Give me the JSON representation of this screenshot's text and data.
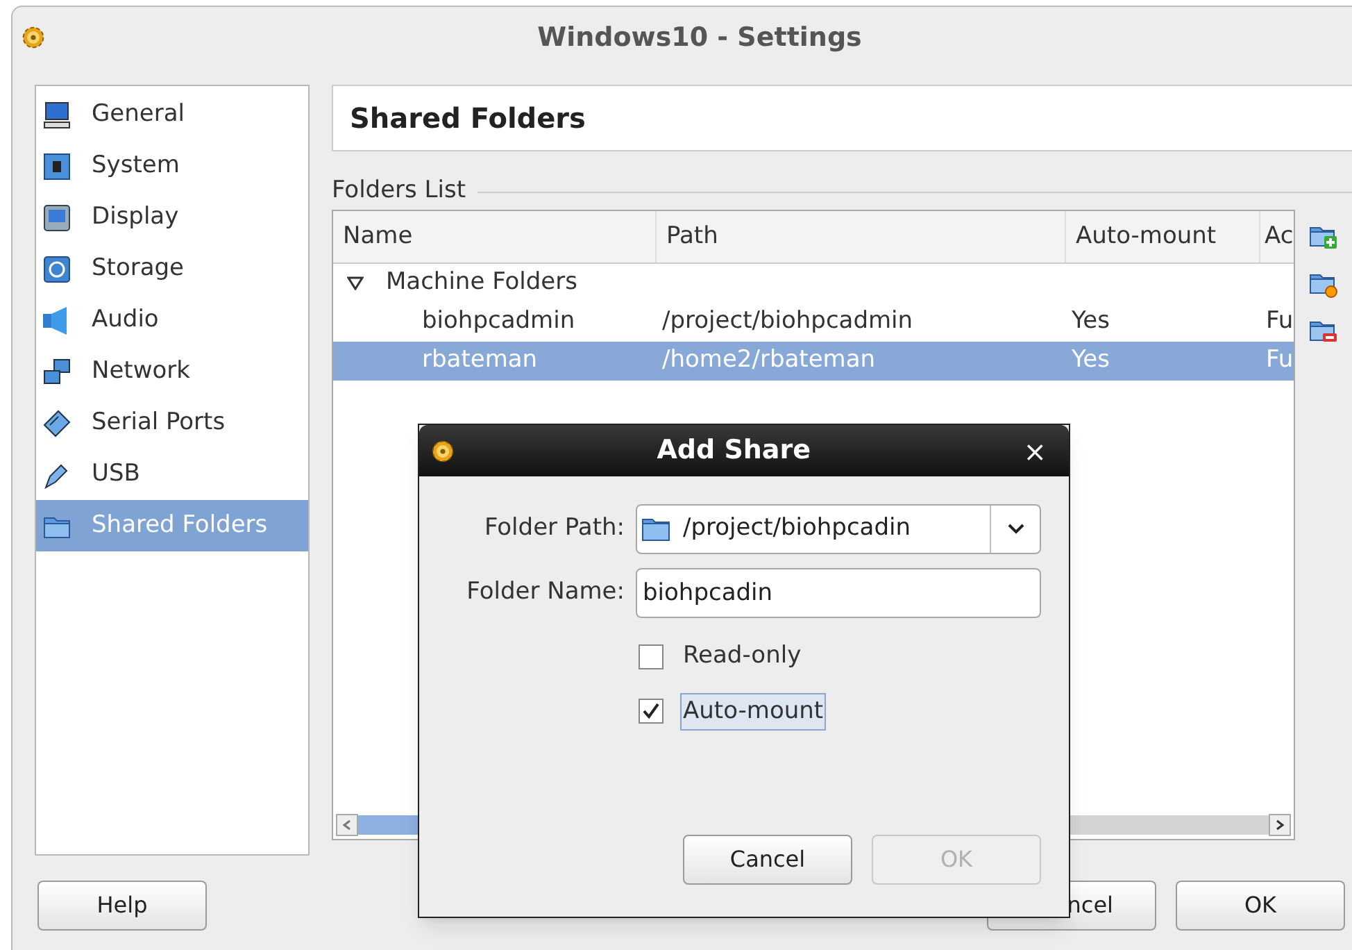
{
  "window": {
    "title": "Windows10 - Settings"
  },
  "sidebar": {
    "items": [
      {
        "label": "General",
        "selected": false
      },
      {
        "label": "System",
        "selected": false
      },
      {
        "label": "Display",
        "selected": false
      },
      {
        "label": "Storage",
        "selected": false
      },
      {
        "label": "Audio",
        "selected": false
      },
      {
        "label": "Network",
        "selected": false
      },
      {
        "label": "Serial Ports",
        "selected": false
      },
      {
        "label": "USB",
        "selected": false
      },
      {
        "label": "Shared Folders",
        "selected": true
      }
    ]
  },
  "page": {
    "title": "Shared Folders",
    "group_label": "Folders List"
  },
  "table": {
    "columns": [
      "Name",
      "Path",
      "Auto-mount",
      "Ac"
    ],
    "groups": [
      {
        "label": "Machine Folders",
        "expanded": true,
        "rows": [
          {
            "cells": [
              "biohpcadmin",
              "/project/biohpcadmin",
              "Yes",
              "Fu"
            ],
            "selected": false
          },
          {
            "cells": [
              "rbateman",
              "/home2/rbateman",
              "Yes",
              "Fu"
            ],
            "selected": true
          }
        ]
      }
    ]
  },
  "buttons": {
    "help": "Help",
    "cancel": "ncel",
    "ok": "OK"
  },
  "dialog": {
    "title": "Add Share",
    "close": "×",
    "fields": [
      {
        "label": "Folder Path:",
        "value": "/project/biohpcadin",
        "kind": "combo"
      },
      {
        "label": "Folder Name:",
        "value": "biohpcadin",
        "kind": "text"
      }
    ],
    "options": [
      {
        "label": "Read-only",
        "checked": false,
        "focused": false
      },
      {
        "label": "Auto-mount",
        "checked": true,
        "focused": true
      }
    ],
    "buttons": [
      {
        "label": "Cancel",
        "disabled": false
      },
      {
        "label": "OK",
        "disabled": true
      }
    ]
  }
}
